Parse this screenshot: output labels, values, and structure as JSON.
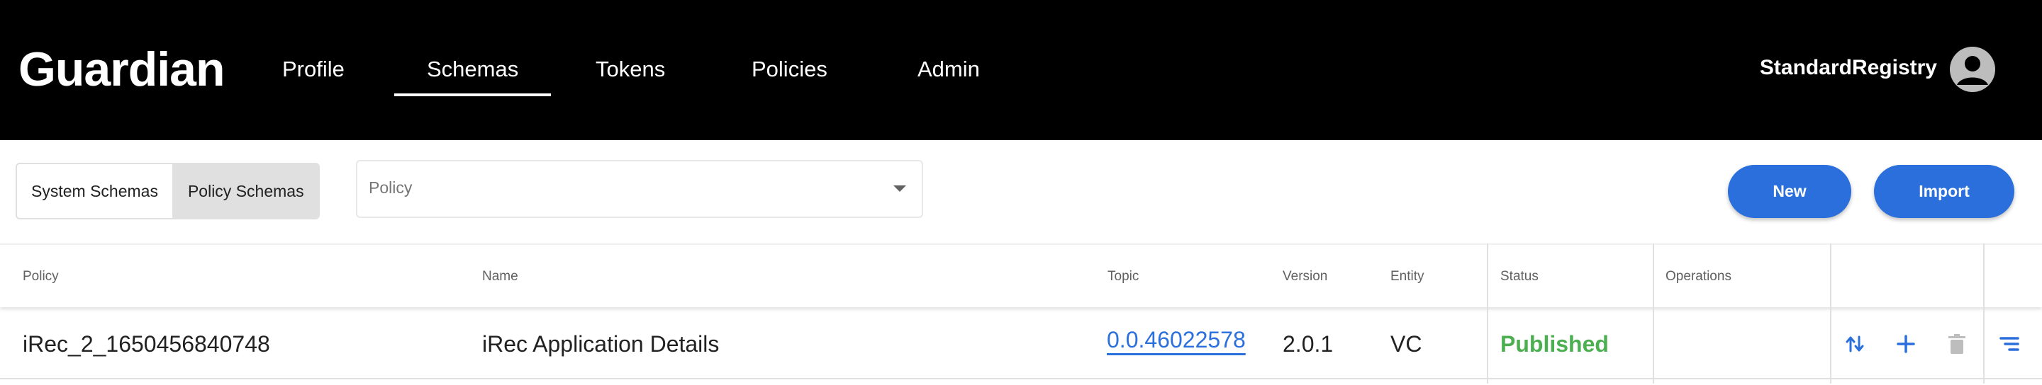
{
  "app": {
    "title": "Guardian"
  },
  "nav": {
    "items": [
      "Profile",
      "Schemas",
      "Tokens",
      "Policies",
      "Admin"
    ],
    "active": "Schemas"
  },
  "user": {
    "name": "StandardRegistry"
  },
  "toolbar": {
    "tabs": [
      {
        "label": "System Schemas",
        "selected": false
      },
      {
        "label": "Policy Schemas",
        "selected": true
      }
    ],
    "policy_select": {
      "placeholder": "Policy"
    },
    "new_label": "New",
    "import_label": "Import"
  },
  "table": {
    "columns": [
      "Policy",
      "Name",
      "Topic",
      "Version",
      "Entity",
      "Status",
      "Operations"
    ],
    "rows": [
      {
        "policy": "iRec_2_1650456840748",
        "name": "iRec Application Details",
        "topic": "0.0.46022578",
        "version": "2.0.1",
        "entity": "VC",
        "status": "Published"
      }
    ],
    "operation_icons": [
      "swap-vert-icon",
      "add-icon",
      "delete-icon",
      "menu-lines-icon"
    ]
  },
  "colors": {
    "header_bg": "#000000",
    "accent": "#2a6fdb",
    "status_published": "#4caf50",
    "icon_disabled": "#bdbdbd"
  }
}
